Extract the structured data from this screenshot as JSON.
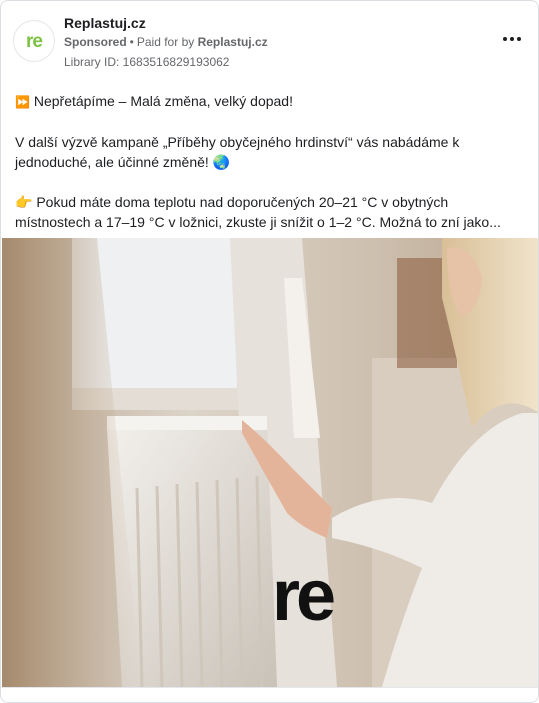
{
  "header": {
    "page_name": "Replastuj.cz",
    "avatar_text": "re",
    "sponsored": "Sponsored",
    "separator": "•",
    "paid_for_by": "Paid for by",
    "payer": "Replastuj.cz",
    "library_id": "Library ID: 1683516829193062"
  },
  "post": {
    "line1_emoji": "⏩",
    "line1": "Nepřetápíme – Malá změna, velký dopad!",
    "para2": "V další výzvě kampaně „Příběhy obyčejného hrdinství“ vás nabádáme k jednoduché, ale účinné změně!",
    "para2_emoji": "🌏",
    "para3_emoji": "👉",
    "para3_line1": "Pokud máte doma teplotu nad doporučených 20–21 °C v obytných",
    "para3_line2": "místnostech a 17–19 °C v ložnici, zkuste ji snížit o 1–2 °C. Možná to zní jako..."
  },
  "media": {
    "logo_text": "re",
    "colors": {
      "wall": "#d9cfc3",
      "radiator": "#ece8e2",
      "sweater": "#efebe6",
      "hair": "#e9d7b6",
      "logo": "#111111"
    }
  }
}
